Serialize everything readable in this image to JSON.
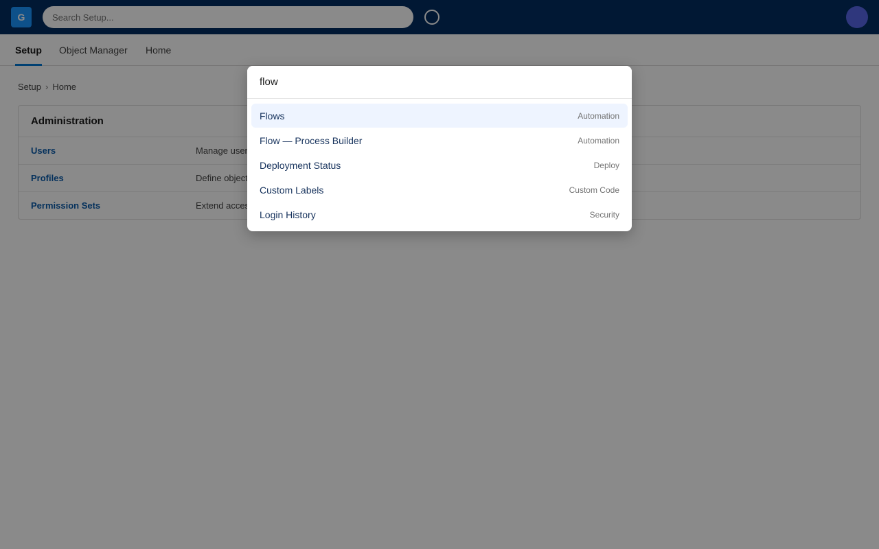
{
  "header": {
    "logo_text": "G",
    "search_placeholder": "Search Setup...",
    "brand_color": "#032d60"
  },
  "tabs": [
    {
      "label": "Setup",
      "active": true
    },
    {
      "label": "Object Manager",
      "active": false
    },
    {
      "label": "Home",
      "active": false
    }
  ],
  "breadcrumb": [
    "Setup",
    "Home"
  ],
  "admin": {
    "title": "Administration",
    "rows": [
      {
        "link": "Users",
        "desc": "Manage user"
      },
      {
        "link": "Profiles",
        "desc": "Define object"
      },
      {
        "link": "Permission Sets",
        "desc": "Extend access"
      }
    ]
  },
  "palette": {
    "query": "flow",
    "results": [
      {
        "label": "Flows",
        "category": "Automation",
        "selected": true
      },
      {
        "label": "Flow — Process Builder",
        "category": "Automation",
        "selected": false
      },
      {
        "label": "Deployment Status",
        "category": "Deploy",
        "selected": false
      },
      {
        "label": "Custom Labels",
        "category": "Custom Code",
        "selected": false
      },
      {
        "label": "Login History",
        "category": "Security",
        "selected": false
      }
    ]
  }
}
